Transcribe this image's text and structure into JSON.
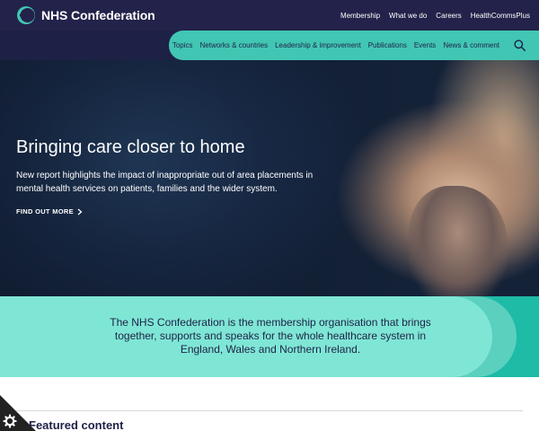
{
  "brand": {
    "name": "NHS Confederation"
  },
  "top_nav": {
    "links": [
      "Membership",
      "What we do",
      "Careers",
      "HealthCommsPlus"
    ]
  },
  "main_nav": {
    "links": [
      "Topics",
      "Networks & countries",
      "Leadership & improvement",
      "Publications",
      "Events",
      "News & comment"
    ]
  },
  "hero": {
    "title": "Bringing care closer to home",
    "description": "New report highlights the impact of inappropriate out of area placements in mental health services on patients, families and the wider system.",
    "cta": "FIND OUT MORE"
  },
  "mission": {
    "text": "The NHS Confederation is the membership organisation that brings together, supports and speaks for the whole healthcare system in England, Wales and Northern Ireland."
  },
  "featured": {
    "title": "Featured content"
  },
  "colors": {
    "navy": "#23224a",
    "teal": "#41c6b3",
    "mint": "#7fe6d5",
    "teal_dark": "#1ebba7"
  },
  "icons": {
    "logo": "nhs-confed-ring-logo",
    "search": "search-icon",
    "cta_arrow": "chevron-right-icon",
    "cookie": "gear-icon"
  }
}
